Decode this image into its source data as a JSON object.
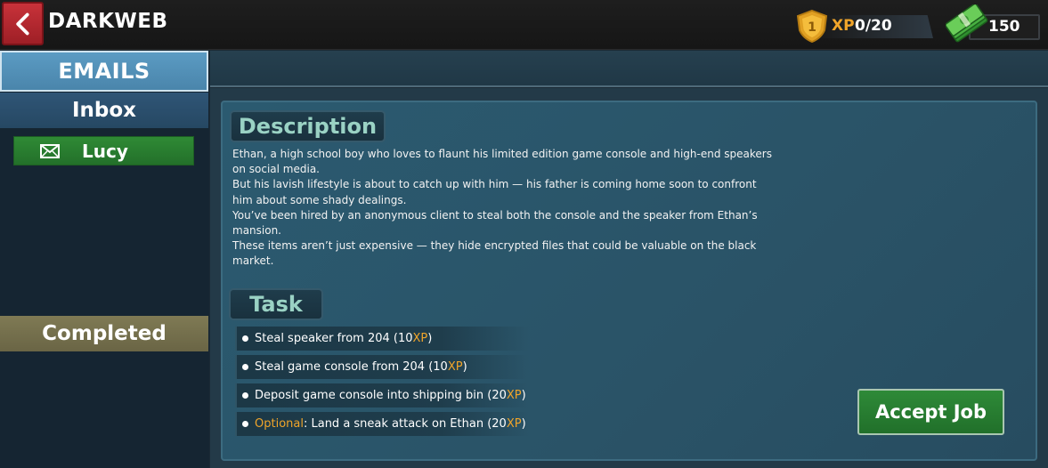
{
  "header": {
    "title": "DARKWEB",
    "xp_label": "XP",
    "xp_value": "0/20",
    "level": "1",
    "money": "150"
  },
  "sidebar": {
    "header": "EMAILS",
    "inbox_label": "Inbox",
    "emails": [
      {
        "name": "Lucy",
        "icon": "envelope-icon"
      }
    ],
    "completed_label": "Completed"
  },
  "description": {
    "heading": "Description",
    "paragraphs": [
      "Ethan, a high school boy who loves to flaunt his limited edition game console and high-end speakers on social media.",
      "But his lavish lifestyle is about to catch up with him — his father is coming home soon to confront him about some shady dealings.",
      "You’ve been hired by an anonymous client to steal both the console and the speaker from Ethan’s mansion.",
      "These items aren’t just expensive — they hide encrypted files that could be valuable on the black market."
    ]
  },
  "tasks": {
    "heading": "Task",
    "items": [
      {
        "prefix": "",
        "text": "Steal speaker from 204 (10",
        "xp": "XP",
        "suffix": ")"
      },
      {
        "prefix": "",
        "text": "Steal game console from 204 (10",
        "xp": "XP",
        "suffix": ")"
      },
      {
        "prefix": "",
        "text": "Deposit game console into shipping bin (20",
        "xp": "XP",
        "suffix": ")"
      },
      {
        "prefix": "Optional",
        "text": ": Land a sneak attack on Ethan (20",
        "xp": "XP",
        "suffix": ")"
      }
    ]
  },
  "accept_button": "Accept Job",
  "colors": {
    "accent_gold": "#f1a52a",
    "accept_green": "#2e8a38",
    "back_red": "#c8323a",
    "panel_teal": "#2b5a70"
  }
}
